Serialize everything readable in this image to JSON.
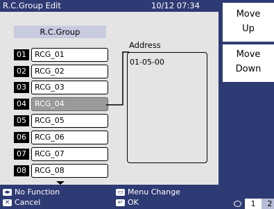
{
  "header": {
    "title": "R.C.Group Edit",
    "datetime": "10/12 07:34"
  },
  "group_header": "R.C.Group",
  "rows": [
    {
      "num": "01",
      "name": "RCG_01"
    },
    {
      "num": "02",
      "name": "RCG_02"
    },
    {
      "num": "03",
      "name": "RCG_03"
    },
    {
      "num": "04",
      "name": "RCG_04"
    },
    {
      "num": "05",
      "name": "RCG_05"
    },
    {
      "num": "06",
      "name": "RCG_06"
    },
    {
      "num": "07",
      "name": "RCG_07"
    },
    {
      "num": "08",
      "name": "RCG_08"
    }
  ],
  "selected_row": "04",
  "address": {
    "label": "Address",
    "value": "01-05-00"
  },
  "side_buttons": {
    "move_up": [
      "Move",
      "Up"
    ],
    "move_down": [
      "Move",
      "Down"
    ]
  },
  "footer": {
    "no_function": "No Function",
    "cancel": "Cancel",
    "menu_change": "Menu Change",
    "ok": "OK"
  },
  "pager": {
    "page1": "1",
    "page2": "2"
  },
  "colors": {
    "background": "#2e3a73",
    "panel": "#e4e4e4",
    "header_band": "#c6cbe0",
    "selected": "#9a9a9a"
  }
}
